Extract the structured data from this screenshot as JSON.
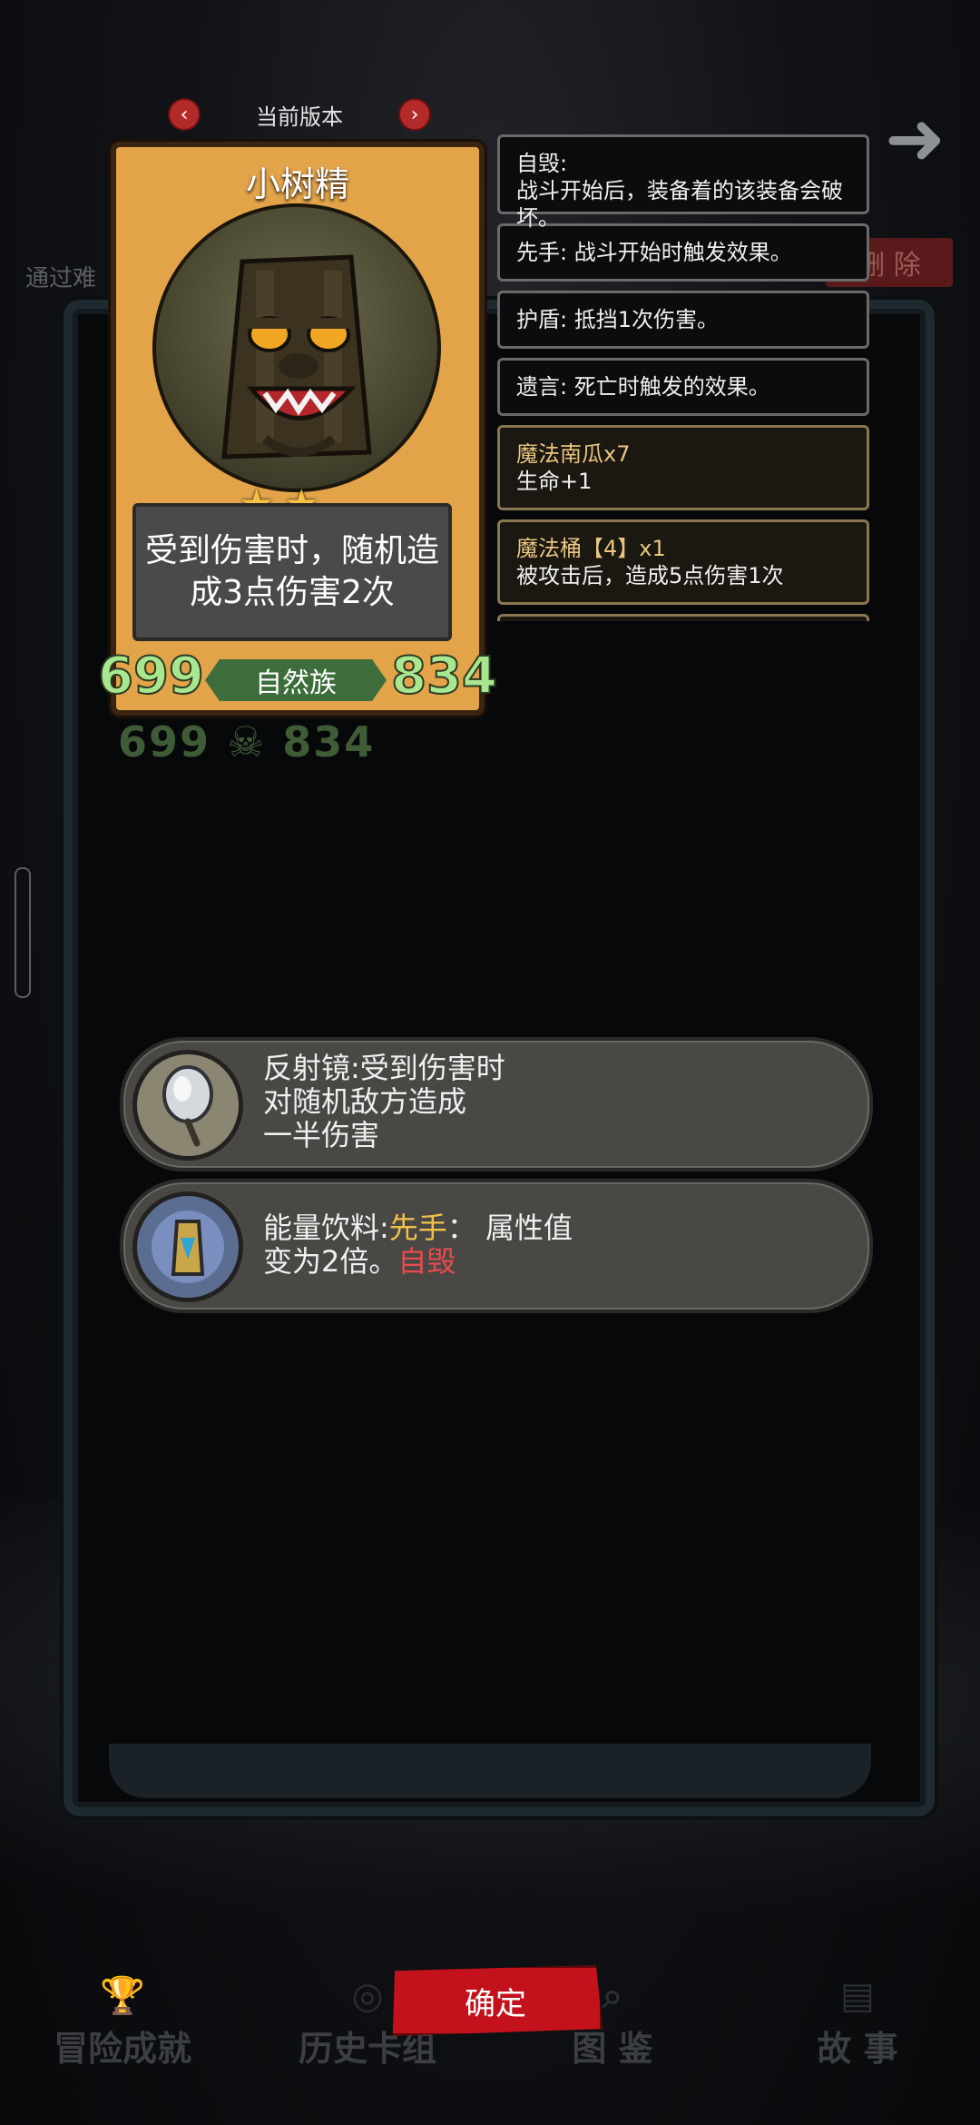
{
  "background": {
    "behind_label": "通过难",
    "behind_delete": "删 除"
  },
  "version_nav": {
    "label": "当前版本",
    "prev": "‹",
    "next": "›"
  },
  "card": {
    "name": "小树精",
    "stars": 2,
    "description": "受到伤害时，随机造成3点伤害2次",
    "attack": "699",
    "health": "834",
    "tribe": "自然族",
    "ghost_stats": "699 ☠ 834"
  },
  "keywords": [
    {
      "title": "自毁:",
      "text": "战斗开始后，装备着的该装备会破坏。",
      "style": "plain"
    },
    {
      "title": "",
      "text": "先手: 战斗开始时触发效果。",
      "style": "plain"
    },
    {
      "title": "",
      "text": "护盾: 抵挡1次伤害。",
      "style": "plain"
    },
    {
      "title": "",
      "text": "遗言: 死亡时触发的效果。",
      "style": "plain"
    },
    {
      "title": "魔法南瓜x7",
      "text": "生命+1",
      "style": "gold"
    },
    {
      "title": "魔法桶【4】x1",
      "text": "被攻击后，造成5点伤害1次",
      "style": "gold"
    }
  ],
  "equipment": [
    {
      "name": "反射镜",
      "text_line1": "反射镜:受到伤害时",
      "text_line2": "对随机敌方造成",
      "text_line3": "一半伤害"
    },
    {
      "name": "能量饮料",
      "prefix": "能量饮料:",
      "kw1": "先手",
      "mid": "：  属性值",
      "line2_pre": "变为2倍。",
      "kw2": "自毁"
    }
  ],
  "confirm_label": "确定",
  "bottom_nav": [
    {
      "label": "冒险成就",
      "icon": "trophy-icon"
    },
    {
      "label": "历史卡组",
      "icon": "history-icon"
    },
    {
      "label": "图 鉴",
      "icon": "search-icon"
    },
    {
      "label": "故 事",
      "icon": "book-icon"
    }
  ],
  "colors": {
    "accent_red": "#c3121b",
    "stat_green": "#a8e78f",
    "keyword_yellow": "#f3c14a",
    "keyword_red": "#e84b4b"
  }
}
